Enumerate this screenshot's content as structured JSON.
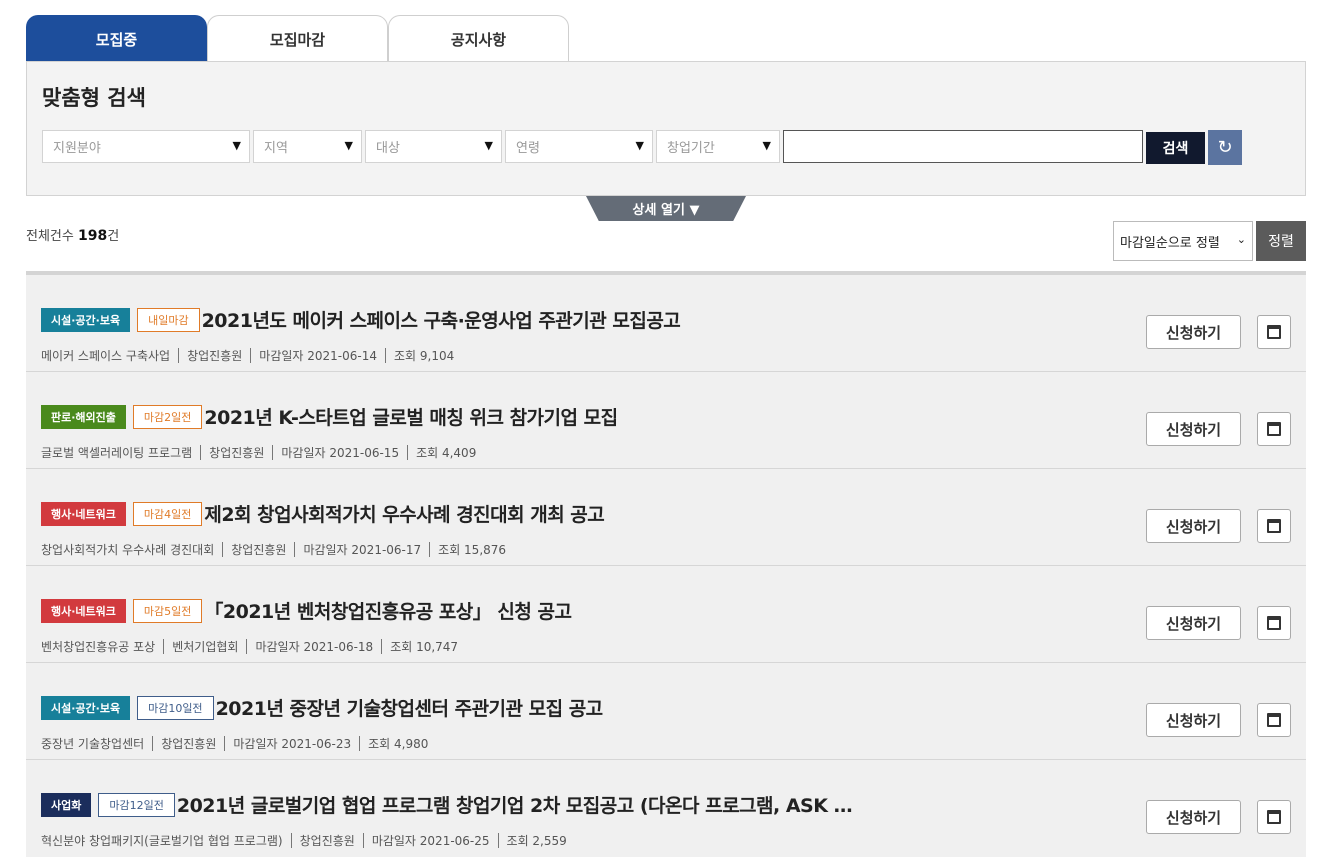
{
  "tabs": [
    {
      "label": "모집중",
      "active": true
    },
    {
      "label": "모집마감",
      "active": false
    },
    {
      "label": "공지사항",
      "active": false
    }
  ],
  "search": {
    "title": "맞춤형 검색",
    "filters": [
      "지원분야",
      "지역",
      "대상",
      "연령",
      "창업기간"
    ],
    "input_value": "",
    "button": "검색",
    "reset_icon": "refresh-icon",
    "detail_toggle": "상세 열기 ▼"
  },
  "summary": {
    "total_label": "전체건수",
    "total_count": "198",
    "total_unit": "건",
    "sort_option": "마감일순으로 정렬",
    "sort_button": "정렬"
  },
  "colors": {
    "tab_active": "#1d4e9c",
    "cat_facility": "#17809a",
    "cat_market": "#4a8a1c",
    "cat_event": "#d23a3e",
    "cat_business": "#1b2d5c",
    "dday_urgent": "#e07b28",
    "dday_normal": "#3f5d8a"
  },
  "items": [
    {
      "category": "시설·공간·보육",
      "cat_color": "#17809a",
      "dday": "내일마감",
      "dday_color": "#e07b28",
      "title": "2021년도 메이커 스페이스 구축·운영사업 주관기관 모집공고",
      "program": "메이커 스페이스 구축사업",
      "org": "창업진흥원",
      "deadline": "마감일자 2021-06-14",
      "views": "조회 9,104",
      "apply": "신청하기"
    },
    {
      "category": "판로·해외진출",
      "cat_color": "#4a8a1c",
      "dday": "마감2일전",
      "dday_color": "#e07b28",
      "title": "2021년 K-스타트업 글로벌 매칭 위크 참가기업 모집",
      "program": "글로벌 액셀러레이팅 프로그램",
      "org": "창업진흥원",
      "deadline": "마감일자 2021-06-15",
      "views": "조회 4,409",
      "apply": "신청하기"
    },
    {
      "category": "행사·네트워크",
      "cat_color": "#d23a3e",
      "dday": "마감4일전",
      "dday_color": "#e07b28",
      "title": "제2회 창업사회적가치 우수사례 경진대회 개최 공고",
      "program": "창업사회적가치 우수사례 경진대회",
      "org": "창업진흥원",
      "deadline": "마감일자 2021-06-17",
      "views": "조회 15,876",
      "apply": "신청하기"
    },
    {
      "category": "행사·네트워크",
      "cat_color": "#d23a3e",
      "dday": "마감5일전",
      "dday_color": "#e07b28",
      "title": "「2021년 벤처창업진흥유공 포상」 신청 공고",
      "program": "벤처창업진흥유공 포상",
      "org": "벤처기업협회",
      "deadline": "마감일자 2021-06-18",
      "views": "조회 10,747",
      "apply": "신청하기"
    },
    {
      "category": "시설·공간·보육",
      "cat_color": "#17809a",
      "dday": "마감10일전",
      "dday_color": "#3f5d8a",
      "title": "2021년 중장년 기술창업센터 주관기관 모집 공고",
      "program": "중장년 기술창업센터",
      "org": "창업진흥원",
      "deadline": "마감일자 2021-06-23",
      "views": "조회 4,980",
      "apply": "신청하기"
    },
    {
      "category": "사업화",
      "cat_color": "#1b2d5c",
      "dday": "마감12일전",
      "dday_color": "#3f5d8a",
      "title": "2021년 글로벌기업 협업 프로그램 창업기업 2차 모집공고 (다온다 프로그램, ASK …",
      "program": "혁신분야 창업패키지(글로벌기업 협업 프로그램)",
      "org": "창업진흥원",
      "deadline": "마감일자 2021-06-25",
      "views": "조회 2,559",
      "apply": "신청하기"
    }
  ]
}
